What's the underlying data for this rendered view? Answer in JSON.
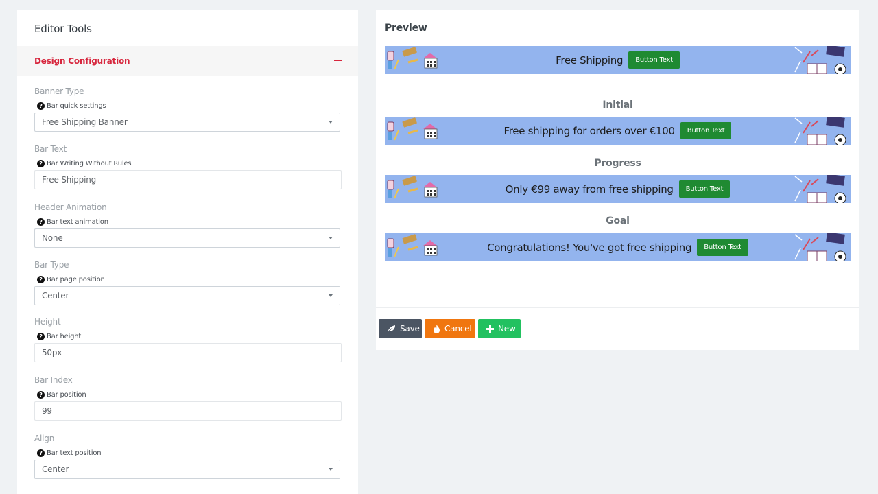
{
  "editor": {
    "title": "Editor Tools",
    "section_title": "Design Configuration",
    "fields": [
      {
        "label": "Banner Type",
        "hint": "Bar quick settings",
        "type": "select",
        "value": "Free Shipping Banner"
      },
      {
        "label": "Bar Text",
        "hint": "Bar Writing Without Rules",
        "type": "input",
        "value": "Free Shipping"
      },
      {
        "label": "Header Animation",
        "hint": "Bar text animation",
        "type": "select",
        "value": "None"
      },
      {
        "label": "Bar Type",
        "hint": "Bar page position",
        "type": "select",
        "value": "Center"
      },
      {
        "label": "Height",
        "hint": "Bar height",
        "type": "input",
        "value": "50px"
      },
      {
        "label": "Bar Index",
        "hint": "Bar position",
        "type": "input",
        "value": "99"
      },
      {
        "label": "Align",
        "hint": "Bar text position",
        "type": "select",
        "value": "Center"
      }
    ]
  },
  "preview": {
    "title": "Preview",
    "banners": [
      {
        "state": "",
        "text": "Free Shipping",
        "button": "Button Text"
      },
      {
        "state": "Initial",
        "text": "Free shipping for orders over €100",
        "button": "Button Text"
      },
      {
        "state": "Progress",
        "text": "Only €99 away from free shipping",
        "button": "Button Text"
      },
      {
        "state": "Goal",
        "text": "Congratulations! You've got free shipping",
        "button": "Button Text"
      }
    ],
    "banner_color": "#93b4ee",
    "banner_button_color": "#1f8a32"
  },
  "actions": {
    "save": "Save",
    "cancel": "Cancel",
    "new": "New",
    "save_icon": "leaf-icon",
    "cancel_icon": "fire-icon",
    "new_icon": "plus-icon"
  }
}
